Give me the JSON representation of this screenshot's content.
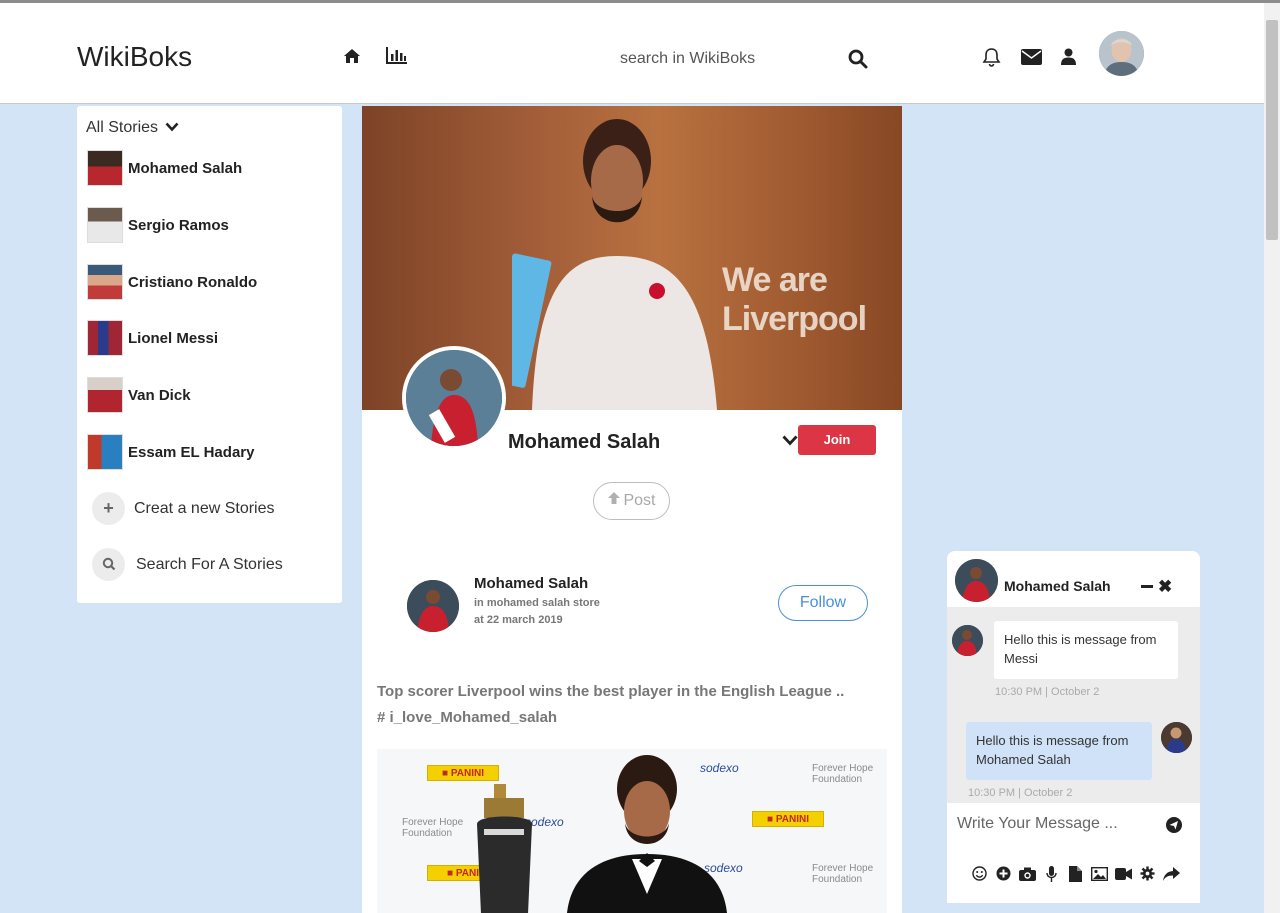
{
  "header": {
    "logo": "WikiBoks",
    "search_placeholder": "search in WikiBoks"
  },
  "sidebar": {
    "title": "All Stories",
    "items": [
      {
        "name": "Mohamed Salah",
        "color": "#b8262e"
      },
      {
        "name": "Sergio Ramos",
        "color": "#e8e8e8"
      },
      {
        "name": "Cristiano Ronaldo",
        "color": "#c23b3b"
      },
      {
        "name": "Lionel Messi",
        "color": "#2b3b8c"
      },
      {
        "name": "Van Dick",
        "color": "#b12530"
      },
      {
        "name": "Essam EL Hadary",
        "color": "#2a7fc0"
      }
    ],
    "create_label": "Creat a new Stories",
    "search_label": "Search For A Stories"
  },
  "profile": {
    "cover_text": "We are Liverpool",
    "name": "Mohamed Salah",
    "join_label": "Join",
    "post_label": "Post"
  },
  "post": {
    "author": "Mohamed Salah",
    "location": "in mohamed salah store",
    "date": "at 22 march 2019",
    "follow_label": "Follow",
    "text": "Top scorer Liverpool wins the best player in the English League ..",
    "hashtag": "# i_love_Mohamed_salah"
  },
  "chat": {
    "name": "Mohamed Salah",
    "messages": [
      {
        "text": "Hello this is message from Messi",
        "time": "10:30 PM | October 2",
        "direction": "in"
      },
      {
        "text": "Hello this is message from Mohamed Salah",
        "time": "10:30 PM | October 2",
        "direction": "out"
      }
    ],
    "input_placeholder": "Write Your Message ...",
    "tools": [
      "smile-icon",
      "plus-circle-icon",
      "camera-icon",
      "microphone-icon",
      "file-icon",
      "image-icon",
      "video-icon",
      "gear-icon",
      "share-icon"
    ]
  },
  "colors": {
    "background": "#d3e4f7",
    "join": "#dc3545",
    "follow": "#4a90d9",
    "bubble_out": "#cfe2f7"
  }
}
